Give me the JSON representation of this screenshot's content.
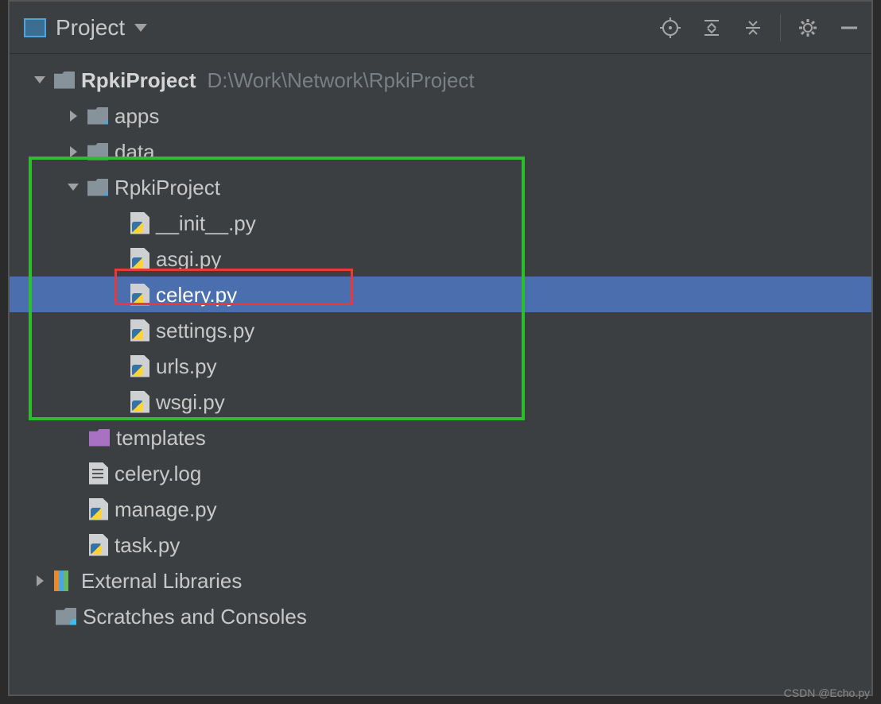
{
  "toolbar": {
    "title": "Project"
  },
  "tree": {
    "root": {
      "name": "RpkiProject",
      "path": "D:\\Work\\Network\\RpkiProject"
    },
    "apps": "apps",
    "data": "data",
    "rpki": "RpkiProject",
    "files": {
      "init": "__init__.py",
      "asgi": "asgi.py",
      "celery": "celery.py",
      "settings": "settings.py",
      "urls": "urls.py",
      "wsgi": "wsgi.py"
    },
    "templates": "templates",
    "celerylog": "celery.log",
    "manage": "manage.py",
    "task": "task.py",
    "external": "External Libraries",
    "scratches": "Scratches and Consoles"
  },
  "watermark": "CSDN @Echo.py"
}
